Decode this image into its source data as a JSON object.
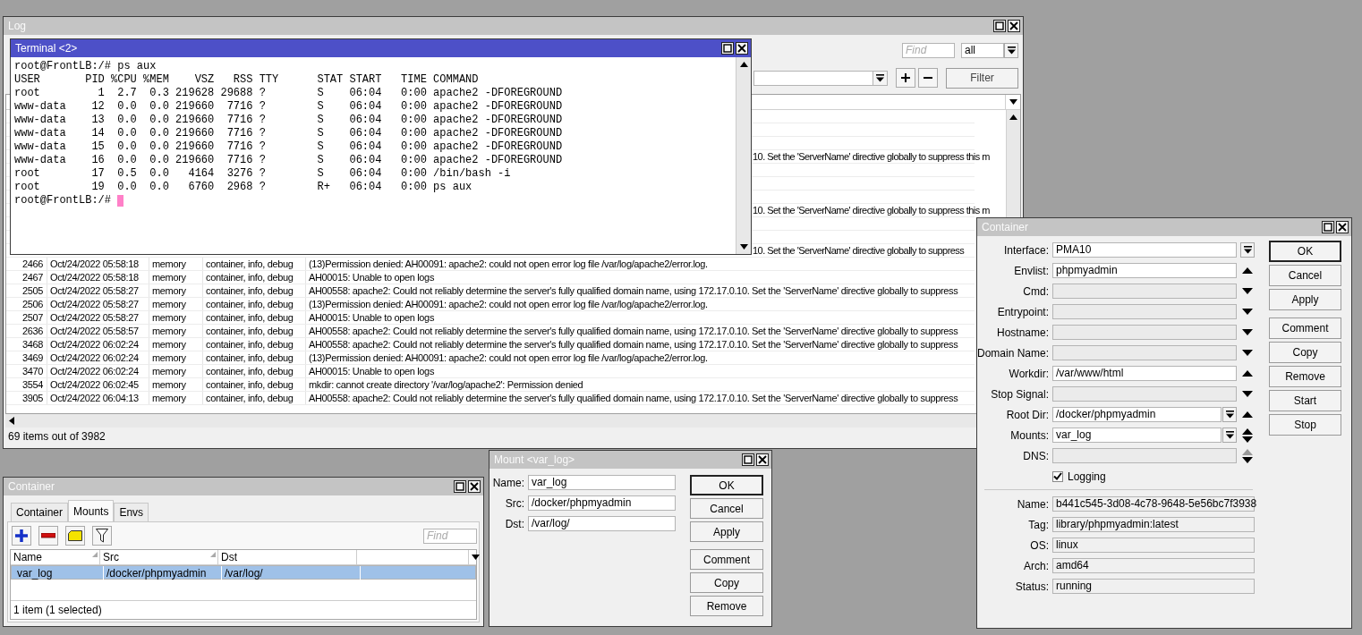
{
  "log_window": {
    "title": "Log",
    "active": false,
    "find": {
      "placeholder": "Find"
    },
    "topic_select": {
      "value": "all"
    },
    "filter_button": "Filter",
    "rows_behind_terminal": [
      {
        "kind": "blank"
      },
      {
        "kind": "blank"
      },
      {
        "kind": "blank"
      },
      {
        "kind": "text",
        "message_tail": "10. Set the 'ServerName' directive globally to suppress this m"
      },
      {
        "kind": "blank"
      },
      {
        "kind": "blank"
      },
      {
        "kind": "blank"
      },
      {
        "kind": "text",
        "message_tail": "10. Set the 'ServerName' directive globally to suppress this m"
      },
      {
        "kind": "blank"
      },
      {
        "kind": "blank"
      },
      {
        "kind": "text",
        "message_tail": "10. Set the 'ServerName' directive globally to suppress"
      }
    ],
    "rows": [
      {
        "id": "2466",
        "time": "Oct/24/2022 05:58:18",
        "column_3": "memory",
        "topics": "container, info, debug",
        "message": "(13)Permission denied: AH00091: apache2: could not open error log file /var/log/apache2/error.log."
      },
      {
        "id": "2467",
        "time": "Oct/24/2022 05:58:18",
        "column_3": "memory",
        "topics": "container, info, debug",
        "message": "AH00015: Unable to open logs"
      },
      {
        "id": "2505",
        "time": "Oct/24/2022 05:58:27",
        "column_3": "memory",
        "topics": "container, info, debug",
        "message": "AH00558: apache2: Could not reliably determine the server's fully qualified domain name, using 172.17.0.10. Set the 'ServerName' directive globally to suppress"
      },
      {
        "id": "2506",
        "time": "Oct/24/2022 05:58:27",
        "column_3": "memory",
        "topics": "container, info, debug",
        "message": "(13)Permission denied: AH00091: apache2: could not open error log file /var/log/apache2/error.log."
      },
      {
        "id": "2507",
        "time": "Oct/24/2022 05:58:27",
        "column_3": "memory",
        "topics": "container, info, debug",
        "message": "AH00015: Unable to open logs"
      },
      {
        "id": "2636",
        "time": "Oct/24/2022 05:58:57",
        "column_3": "memory",
        "topics": "container, info, debug",
        "message": "AH00558: apache2: Could not reliably determine the server's fully qualified domain name, using 172.17.0.10. Set the 'ServerName' directive globally to suppress"
      },
      {
        "id": "3468",
        "time": "Oct/24/2022 06:02:24",
        "column_3": "memory",
        "topics": "container, info, debug",
        "message": "AH00558: apache2: Could not reliably determine the server's fully qualified domain name, using 172.17.0.10. Set the 'ServerName' directive globally to suppress"
      },
      {
        "id": "3469",
        "time": "Oct/24/2022 06:02:24",
        "column_3": "memory",
        "topics": "container, info, debug",
        "message": "(13)Permission denied: AH00091: apache2: could not open error log file /var/log/apache2/error.log."
      },
      {
        "id": "3470",
        "time": "Oct/24/2022 06:02:24",
        "column_3": "memory",
        "topics": "container, info, debug",
        "message": "AH00015: Unable to open logs"
      },
      {
        "id": "3554",
        "time": "Oct/24/2022 06:02:45",
        "column_3": "memory",
        "topics": "container, info, debug",
        "message": "mkdir: cannot create directory '/var/log/apache2': Permission denied"
      },
      {
        "id": "3905",
        "time": "Oct/24/2022 06:04:13",
        "column_3": "memory",
        "topics": "container, info, debug",
        "message": "AH00558: apache2: Could not reliably determine the server's fully qualified domain name, using 172.17.0.10. Set the 'ServerName' directive globally to suppress"
      }
    ],
    "status": "69 items out of 3982"
  },
  "terminal_window": {
    "title": "Terminal <2>",
    "active": true,
    "lines": [
      "root@FrontLB:/# ps aux",
      "USER       PID %CPU %MEM    VSZ   RSS TTY      STAT START   TIME COMMAND",
      "root         1  2.7  0.3 219628 29688 ?        S    06:04   0:00 apache2 -DFOREGROUND",
      "www-data    12  0.0  0.0 219660  7716 ?        S    06:04   0:00 apache2 -DFOREGROUND",
      "www-data    13  0.0  0.0 219660  7716 ?        S    06:04   0:00 apache2 -DFOREGROUND",
      "www-data    14  0.0  0.0 219660  7716 ?        S    06:04   0:00 apache2 -DFOREGROUND",
      "www-data    15  0.0  0.0 219660  7716 ?        S    06:04   0:00 apache2 -DFOREGROUND",
      "www-data    16  0.0  0.0 219660  7716 ?        S    06:04   0:00 apache2 -DFOREGROUND",
      "root        17  0.5  0.0   4164  3276 ?        S    06:04   0:00 /bin/bash -i",
      "root        19  0.0  0.0   6760  2968 ?        R+   06:04   0:00 ps aux"
    ],
    "prompt": "root@FrontLB:/#"
  },
  "mounts_window": {
    "title": "Container",
    "active": false,
    "tabs": [
      {
        "label": "Container",
        "selected": false
      },
      {
        "label": "Mounts",
        "selected": true
      },
      {
        "label": "Envs",
        "selected": false
      }
    ],
    "find": {
      "placeholder": "Find"
    },
    "columns": [
      {
        "label": "Name",
        "sort_mark": true
      },
      {
        "label": "Src",
        "sort_mark": true
      },
      {
        "label": "Dst",
        "sort_mark": false
      }
    ],
    "rows": [
      {
        "name": "var_log",
        "src": "/docker/phpmyadmin",
        "dst": "/var/log/",
        "selected": true
      }
    ],
    "status": "1 item (1 selected)"
  },
  "mount_dialog": {
    "title": "Mount <var_log>",
    "active": false,
    "fields": [
      {
        "label": "Name:",
        "value": "var_log"
      },
      {
        "label": "Src:",
        "value": "/docker/phpmyadmin"
      },
      {
        "label": "Dst:",
        "value": "/var/log/"
      }
    ],
    "button_groups": [
      {
        "buttons": [
          {
            "label": "OK",
            "default": true
          },
          {
            "label": "Cancel",
            "default": false
          },
          {
            "label": "Apply",
            "default": false
          }
        ]
      },
      {
        "buttons": [
          {
            "label": "Comment",
            "default": false
          },
          {
            "label": "Copy",
            "default": false
          },
          {
            "label": "Remove",
            "default": false
          }
        ]
      }
    ]
  },
  "container_dialog": {
    "title": "Container",
    "active": false,
    "fields": [
      {
        "label": "Interface:",
        "value": "PMA10",
        "kind": "picker"
      },
      {
        "label": "Envlist:",
        "value": "phpmyadmin",
        "kind": "up"
      },
      {
        "label": "Cmd:",
        "kind": "down"
      },
      {
        "label": "Entrypoint:",
        "kind": "down"
      },
      {
        "label": "Hostname:",
        "kind": "down"
      },
      {
        "label": "Domain Name:",
        "kind": "down"
      },
      {
        "label": "Workdir:",
        "value": "/var/www/html",
        "kind": "up"
      },
      {
        "label": "Stop Signal:",
        "kind": "down"
      },
      {
        "label": "Root Dir:",
        "value": "/docker/phpmyadmin",
        "kind": "pickerup"
      },
      {
        "label": "Mounts:",
        "value": "var_log",
        "kind": "pickerboth"
      },
      {
        "label": "DNS:",
        "kind": "bothdim"
      }
    ],
    "logging": {
      "label": "Logging",
      "checked": true
    },
    "info_fields": [
      {
        "label": "Name:",
        "value": "b441c545-3d08-4c78-9648-5e56bc7f3938"
      },
      {
        "label": "Tag:",
        "value": "library/phpmyadmin:latest"
      },
      {
        "label": "OS:",
        "value": "linux"
      },
      {
        "label": "Arch:",
        "value": "amd64"
      },
      {
        "label": "Status:",
        "value": "running"
      }
    ],
    "button_groups": [
      {
        "buttons": [
          {
            "label": "OK",
            "default": true
          },
          {
            "label": "Cancel",
            "default": false
          },
          {
            "label": "Apply",
            "default": false
          }
        ]
      },
      {
        "buttons": [
          {
            "label": "Comment",
            "default": false
          },
          {
            "label": "Copy",
            "default": false
          },
          {
            "label": "Remove",
            "default": false
          },
          {
            "label": "Start",
            "default": false
          },
          {
            "label": "Stop",
            "default": false
          }
        ]
      }
    ]
  }
}
